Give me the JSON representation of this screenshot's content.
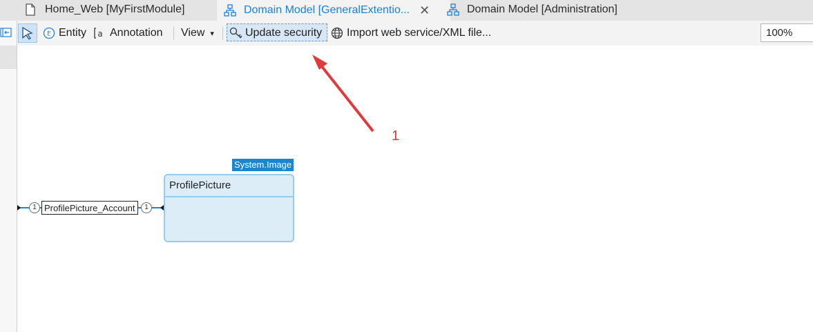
{
  "tabs": [
    {
      "label": "Home_Web [MyFirstModule]",
      "icon": "page-icon",
      "active": false
    },
    {
      "label": "Domain Model [GeneralExtentio...",
      "icon": "domain-model-icon",
      "active": true,
      "close": "✕"
    },
    {
      "label": "Domain Model [Administration]",
      "icon": "domain-model-icon",
      "active": false
    }
  ],
  "toolbar": {
    "entity_label": "Entity",
    "annotation_label": "Annotation",
    "view_label": "View",
    "view_arrow": "▾",
    "update_security_label": "Update security",
    "import_label": "Import web service/XML file...",
    "zoom_value": "100%"
  },
  "canvas": {
    "generalization_label": "System.Image",
    "entity_name": "ProfilePicture",
    "association_name": "ProfilePicture_Account",
    "multiplicity_left": "1",
    "multiplicity_right": "1",
    "annotation_number": "1"
  },
  "colors": {
    "accent": "#1e7fd6",
    "entity_fill": "#dcedf8",
    "entity_border": "#92cdf0",
    "generalization_bg": "#1a86d0",
    "arrow": "#e23a3a"
  }
}
